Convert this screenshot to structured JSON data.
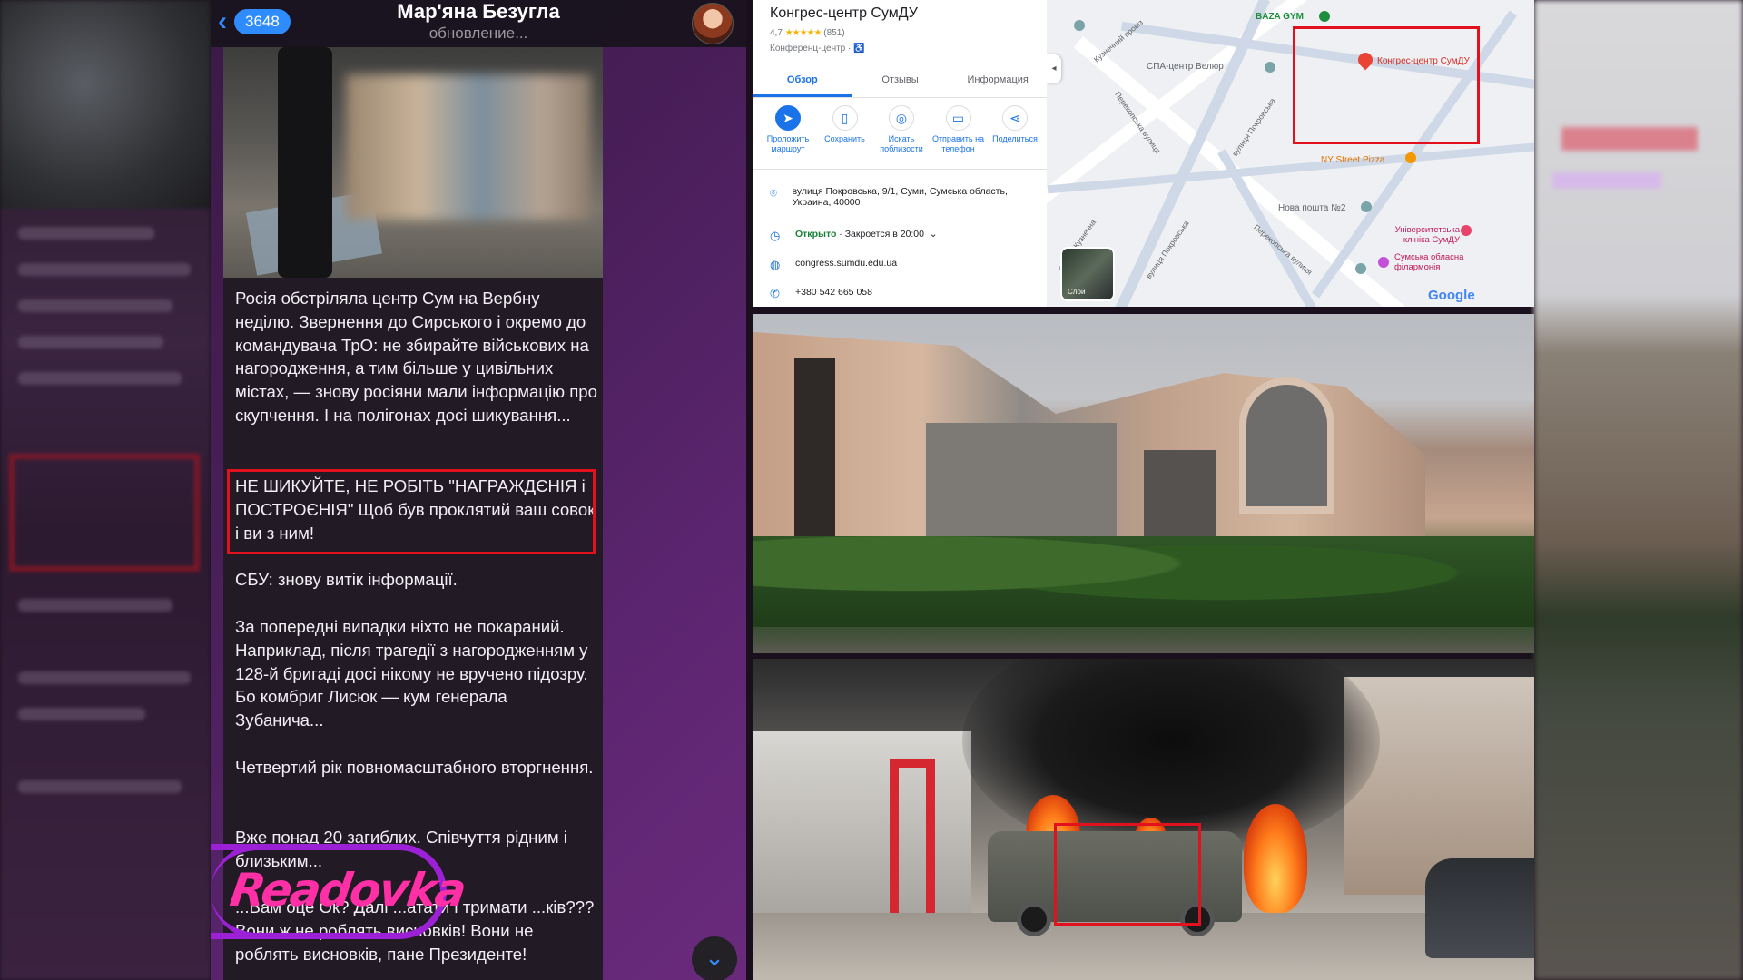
{
  "telegram": {
    "back_count": "3648",
    "channel_name": "Мар'яна Безугла",
    "status": "обновление...",
    "paragraphs": [
      "Росія обстріляла центр Сум на Вербну неділю. Звернення до Сирського і окремо до командувача ТрО: не збирайте військових на нагородження, а тим більше у цивільних містах, — знову росіяни мали інформацію про скупчення. І на полігонах досі шикування...",
      "НЕ ШИКУЙТЕ, НЕ РОБІТЬ \"НАГРАЖДЄНІЯ і ПОСТРОЄНІЯ\" Щоб був проклятий ваш совок і ви з ним!",
      "СБУ: знову витік інформації.",
      "За попередні випадки ніхто не покараний. Наприклад, після трагедії з нагородженням у 128-й бригаді досі нікому не вручено підозру. Бо комбриг Лисюк — кум генерала Зубанича...",
      "Четвертий рік повномасштабного вторгнення.",
      "Вже понад 20 загиблих. Співчуття рідним і близьким...",
      "...Вам оце Ок? Далі ...атати і тримати ...ків??? Вони ж не роблять висновків! Вони не роблять висновків, пане Президенте!"
    ],
    "scroll_icon": "chevron-down-icon"
  },
  "watermark": {
    "logo_text": "Readovka"
  },
  "maps": {
    "place_name": "Конгрес-центр СумДУ",
    "rating": "4,7",
    "stars": "★★★★★",
    "reviews": "(851)",
    "category": "Конференц-центр · ♿",
    "tabs": [
      "Обзор",
      "Отзывы",
      "Информация"
    ],
    "actions": [
      {
        "icon": "➤",
        "label": "Проложить маршрут"
      },
      {
        "icon": "▯",
        "label": "Сохранить"
      },
      {
        "icon": "◎",
        "label": "Искать поблизости"
      },
      {
        "icon": "▭",
        "label": "Отправить на телефон"
      },
      {
        "icon": "⋖",
        "label": "Поделиться"
      }
    ],
    "address": "вулиця Покровська, 9/1, Суми, Сумська область, Украина, 40000",
    "hours_open": "Открыто",
    "hours_close": " · Закроется в 20:00",
    "website": "congress.sumdu.edu.ua",
    "phone": "+380 542 665 058",
    "map_labels": {
      "baza_gym": "BAZA GYM",
      "spa": "СПА-центр Велюр",
      "congress": "Конгрес-центр СумДУ",
      "pizza": "NY Street Pizza",
      "nova_poshta": "Нова пошта №2",
      "clinic": "Університетська клініка СумДУ",
      "philharmonic": "Сумська обласна філармонія",
      "street_kuznechny": "Кузнечний провіз",
      "street_pokrovska1": "вулиця Покровська",
      "street_perekopska": "Перекопська вулиця",
      "street_pokrovska2": "вулиця Покровська",
      "street_kuznechna": "вулиця Кузнечна",
      "layers": "Слои",
      "google": "Google"
    },
    "accent": "#1a73e8"
  },
  "colors": {
    "highlight_red": "#e3101e",
    "telegram_blue": "#2f8cff"
  }
}
